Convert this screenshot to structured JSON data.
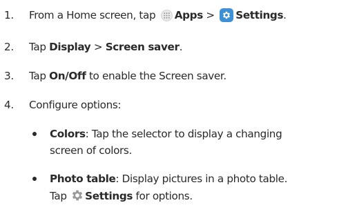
{
  "steps": [
    {
      "num": "1.",
      "prefix": "From a Home screen, tap",
      "apps": "Apps",
      "sep": ">",
      "settings": "Settings",
      "suffix": "."
    },
    {
      "num": "2.",
      "prefix": "Tap",
      "display": "Display",
      "sep": ">",
      "screen_saver": "Screen saver",
      "suffix": "."
    },
    {
      "num": "3.",
      "prefix": "Tap",
      "onoff": "On/Off",
      "suffix": "to enable the Screen saver."
    },
    {
      "num": "4.",
      "text": "Configure options:"
    }
  ],
  "options": [
    {
      "label": "Colors",
      "line1": ": Tap the selector to display a changing",
      "line2": "screen of colors."
    },
    {
      "label": "Photo table",
      "line1": ": Display pictures in a photo table.",
      "line2_prefix": "Tap",
      "line2_settings": "Settings",
      "line2_suffix": "for options."
    }
  ],
  "icons": {
    "apps": "apps-grid-icon",
    "settings": "settings-gear-icon",
    "settings_inline": "gear-icon"
  },
  "colors": {
    "text": "#2a2a2a",
    "settings_bg": "#3d8fd6",
    "gear_grey": "#9a9a9a"
  }
}
